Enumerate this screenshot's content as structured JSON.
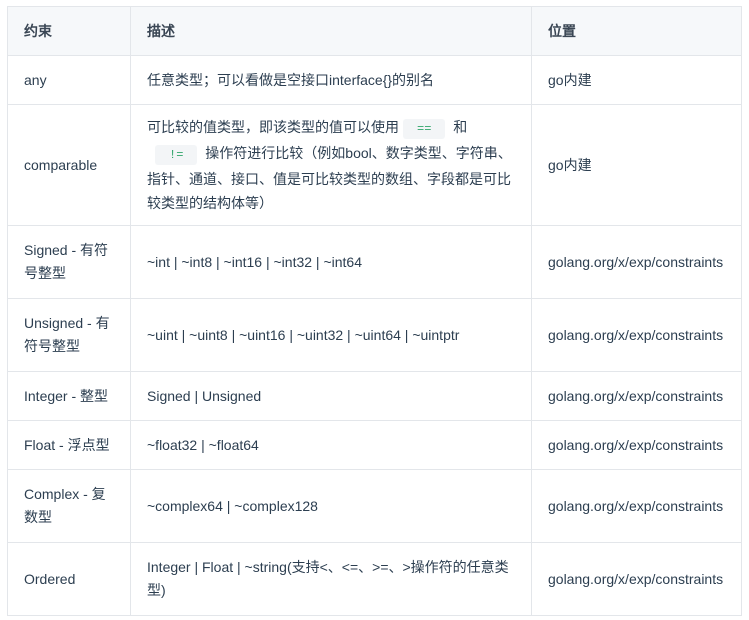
{
  "table": {
    "headers": [
      "约束",
      "描述",
      "位置"
    ],
    "rows": [
      {
        "name": "any",
        "desc": "任意类型；可以看做是空接口interface{}的别名",
        "location": "go内建"
      },
      {
        "name": "comparable",
        "desc_parts": [
          "可比较的值类型，即该类型的值可以使用",
          "==",
          "和",
          "!=",
          "操作符进行比较（例如bool、数字类型、字符串、指针、通道、接口、值是可比较类型的数组、字段都是可比较类型的结构体等）"
        ],
        "location": "go内建"
      },
      {
        "name": "Signed - 有符号整型",
        "desc": "~int | ~int8 | ~int16 | ~int32 | ~int64",
        "location": "golang.org/x/exp/constraints"
      },
      {
        "name": "Unsigned - 有符号整型",
        "desc": "~uint | ~uint8 | ~uint16 | ~uint32 | ~uint64 | ~uintptr",
        "location": "golang.org/x/exp/constraints"
      },
      {
        "name": "Integer - 整型",
        "desc": "Signed | Unsigned",
        "location": "golang.org/x/exp/constraints"
      },
      {
        "name": "Float - 浮点型",
        "desc": "~float32 | ~float64",
        "location": "golang.org/x/exp/constraints"
      },
      {
        "name": "Complex - 复数型",
        "desc": "~complex64 | ~complex128",
        "location": "golang.org/x/exp/constraints"
      },
      {
        "name": "Ordered",
        "desc": "Integer | Float | ~string(支持<、<=、>=、>操作符的任意类型)",
        "location": "golang.org/x/exp/constraints"
      }
    ]
  }
}
